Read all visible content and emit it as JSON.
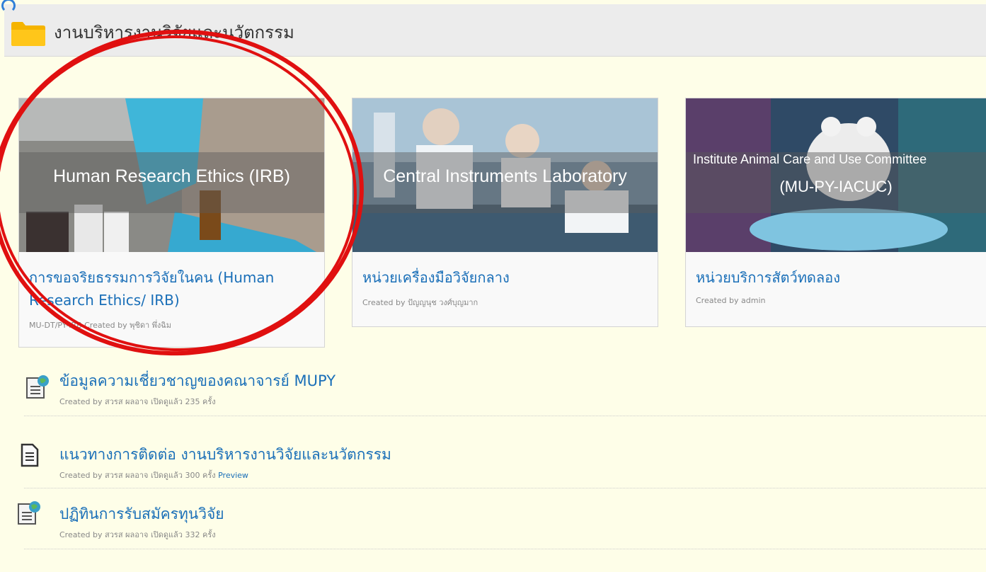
{
  "header": {
    "title": "งานบริหารงานวิจัยและนวัตกรรม",
    "folder_icon": "folder-icon",
    "folder_color": "#f5b400"
  },
  "cards": [
    {
      "banner_text": "Human Research Ethics (IRB)",
      "title": "การขอจริยธรรมการวิจัยในคน (Human Research Ethics/ IRB)",
      "meta": "MU-DT/PY-IRB Created by พุชิดา พึ่งฉิม"
    },
    {
      "banner_text": "Central Instruments Laboratory",
      "title": "หน่วยเครื่องมือวิจัยกลาง",
      "meta": "Created by ปัญญนุช วงศ์บุญมาก"
    },
    {
      "banner_text_line1": "Institute Animal Care and Use Committee",
      "banner_text_line2": "(MU-PY-IACUC)",
      "title": "หน่วยบริการสัตว์ทดลอง",
      "meta": "Created by admin"
    }
  ],
  "items": [
    {
      "icon": "document-globe-icon",
      "label": "ข้อมูลความเชี่ยวชาญของคณาจารย์ MUPY",
      "meta": "Created by สวรส ผลอาจ เปิดดูแล้ว 235 ครั้ง"
    },
    {
      "icon": "document-icon",
      "label": "แนวทางการติดต่อ งานบริหารงานวิจัยและนวัตกรรม",
      "meta": "Created by สวรส ผลอาจ เปิดดูแล้ว 300 ครั้ง",
      "preview": "Preview"
    },
    {
      "icon": "document-globe-icon",
      "label": "ปฏิทินการรับสมัครทุนวิจัย",
      "meta": "Created by สวรส ผลอาจ เปิดดูแล้ว 332 ครั้ง"
    }
  ],
  "colors": {
    "link": "#1a6fb8",
    "highlight_ring": "#e01010",
    "page_background": "#fefee8"
  }
}
